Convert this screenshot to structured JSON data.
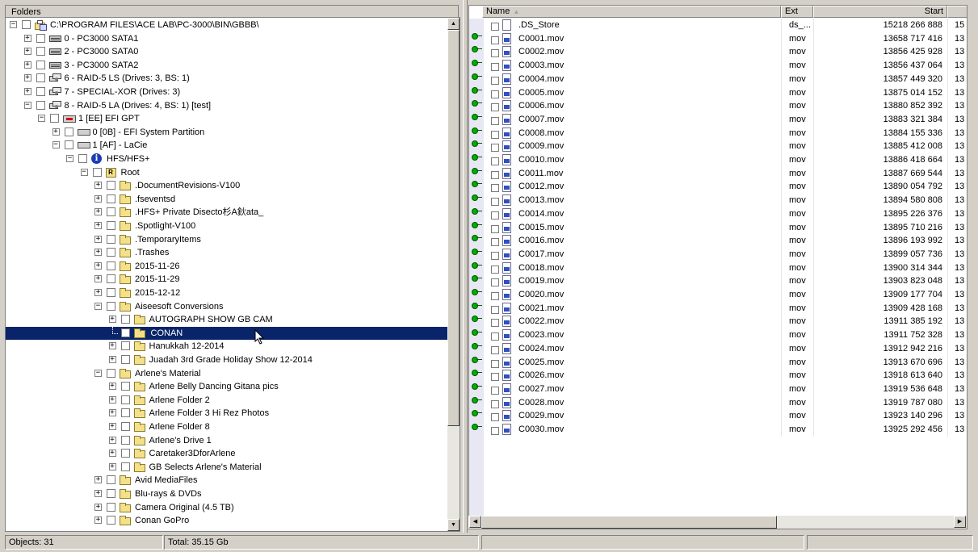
{
  "folders_pane": {
    "header": "Folders",
    "tree": [
      {
        "level": 0,
        "label": "C:\\PROGRAM FILES\\ACE LAB\\PC-3000\\BIN\\GBBB\\",
        "icon": "root-folder-icon",
        "exp": "-"
      },
      {
        "level": 1,
        "label": "0 - PC3000 SATA1",
        "icon": "drive-icon",
        "exp": "+"
      },
      {
        "level": 1,
        "label": "2 - PC3000 SATA0",
        "icon": "drive-icon",
        "exp": "+"
      },
      {
        "level": 1,
        "label": "3 - PC3000 SATA2",
        "icon": "drive-icon",
        "exp": "+"
      },
      {
        "level": 1,
        "label": "6 - RAID-5 LS (Drives: 3, BS: 1)",
        "icon": "raid-icon",
        "exp": "+"
      },
      {
        "level": 1,
        "label": "7 - SPECIAL-XOR (Drives: 3)",
        "icon": "raid-icon",
        "exp": "+"
      },
      {
        "level": 1,
        "label": "8 - RAID-5 LA (Drives: 4, BS: 1) [test]",
        "icon": "raid-icon",
        "exp": "-"
      },
      {
        "level": 2,
        "label": "1 [EE] EFI GPT",
        "icon": "efi-icon",
        "exp": "-"
      },
      {
        "level": 3,
        "label": "0 [0B] - EFI System Partition",
        "icon": "partition-icon",
        "exp": "+"
      },
      {
        "level": 3,
        "label": "1 [AF] - LaCie",
        "icon": "partition-icon",
        "exp": "-"
      },
      {
        "level": 4,
        "label": "HFS/HFS+",
        "icon": "info-icon",
        "exp": "-"
      },
      {
        "level": 5,
        "label": "Root",
        "icon": "root-icon",
        "exp": "-"
      },
      {
        "level": 6,
        "label": ".DocumentRevisions-V100",
        "icon": "folder-icon",
        "exp": "+"
      },
      {
        "level": 6,
        "label": ".fseventsd",
        "icon": "folder-icon",
        "exp": "+"
      },
      {
        "level": 6,
        "label": ".HFS+ Private Disecto杉A鈥ata_",
        "icon": "folder-icon",
        "exp": "+"
      },
      {
        "level": 6,
        "label": ".Spotlight-V100",
        "icon": "folder-icon",
        "exp": "+"
      },
      {
        "level": 6,
        "label": ".TemporaryItems",
        "icon": "folder-icon",
        "exp": "+"
      },
      {
        "level": 6,
        "label": ".Trashes",
        "icon": "folder-icon",
        "exp": "+"
      },
      {
        "level": 6,
        "label": "2015-11-26",
        "icon": "folder-icon",
        "exp": "+"
      },
      {
        "level": 6,
        "label": "2015-11-29",
        "icon": "folder-icon",
        "exp": "+"
      },
      {
        "level": 6,
        "label": "2015-12-12",
        "icon": "folder-icon",
        "exp": "+"
      },
      {
        "level": 6,
        "label": "Aiseesoft Conversions",
        "icon": "folder-icon",
        "exp": "-"
      },
      {
        "level": 7,
        "label": "AUTOGRAPH SHOW GB CAM",
        "icon": "folder-icon",
        "exp": "+"
      },
      {
        "level": 7,
        "label": "CONAN",
        "icon": "folder-icon",
        "exp": "",
        "selected": true
      },
      {
        "level": 7,
        "label": "Hanukkah 12-2014",
        "icon": "folder-icon",
        "exp": "+"
      },
      {
        "level": 7,
        "label": "Juadah 3rd Grade Holiday Show 12-2014",
        "icon": "folder-icon",
        "exp": "+"
      },
      {
        "level": 6,
        "label": "Arlene's Material",
        "icon": "folder-icon",
        "exp": "-"
      },
      {
        "level": 7,
        "label": "Arlene Belly Dancing Gitana pics",
        "icon": "folder-icon",
        "exp": "+"
      },
      {
        "level": 7,
        "label": "Arlene Folder 2",
        "icon": "folder-icon",
        "exp": "+"
      },
      {
        "level": 7,
        "label": "Arlene Folder 3 Hi Rez Photos",
        "icon": "folder-icon",
        "exp": "+"
      },
      {
        "level": 7,
        "label": "Arlene Folder 8",
        "icon": "folder-icon",
        "exp": "+"
      },
      {
        "level": 7,
        "label": "Arlene's Drive 1",
        "icon": "folder-icon",
        "exp": "+"
      },
      {
        "level": 7,
        "label": "Caretaker3DforArlene",
        "icon": "folder-icon",
        "exp": "+"
      },
      {
        "level": 7,
        "label": "GB Selects Arlene's Material",
        "icon": "folder-icon",
        "exp": "+"
      },
      {
        "level": 6,
        "label": "Avid MediaFiles",
        "icon": "folder-icon",
        "exp": "+"
      },
      {
        "level": 6,
        "label": "Blu-rays & DVDs",
        "icon": "folder-icon",
        "exp": "+"
      },
      {
        "level": 6,
        "label": "Camera Original (4.5 TB)",
        "icon": "folder-icon",
        "exp": "+"
      },
      {
        "level": 6,
        "label": "Conan GoPro",
        "icon": "folder-icon",
        "exp": "+"
      }
    ]
  },
  "file_list": {
    "columns": {
      "name": "Name",
      "ext": "Ext",
      "start": "Start"
    },
    "sort_indicator": "▲",
    "rows": [
      {
        "name": ".DS_Store",
        "ext": "ds_...",
        "start": "15218 266 888",
        "extra": "15",
        "type": "plain"
      },
      {
        "name": "C0001.mov",
        "ext": "mov",
        "start": "13658 717 416",
        "extra": "13",
        "type": "mov"
      },
      {
        "name": "C0002.mov",
        "ext": "mov",
        "start": "13856 425 928",
        "extra": "13",
        "type": "mov"
      },
      {
        "name": "C0003.mov",
        "ext": "mov",
        "start": "13856 437 064",
        "extra": "13",
        "type": "mov"
      },
      {
        "name": "C0004.mov",
        "ext": "mov",
        "start": "13857 449 320",
        "extra": "13",
        "type": "mov"
      },
      {
        "name": "C0005.mov",
        "ext": "mov",
        "start": "13875 014 152",
        "extra": "13",
        "type": "mov"
      },
      {
        "name": "C0006.mov",
        "ext": "mov",
        "start": "13880 852 392",
        "extra": "13",
        "type": "mov"
      },
      {
        "name": "C0007.mov",
        "ext": "mov",
        "start": "13883 321 384",
        "extra": "13",
        "type": "mov"
      },
      {
        "name": "C0008.mov",
        "ext": "mov",
        "start": "13884 155 336",
        "extra": "13",
        "type": "mov"
      },
      {
        "name": "C0009.mov",
        "ext": "mov",
        "start": "13885 412 008",
        "extra": "13",
        "type": "mov"
      },
      {
        "name": "C0010.mov",
        "ext": "mov",
        "start": "13886 418 664",
        "extra": "13",
        "type": "mov"
      },
      {
        "name": "C0011.mov",
        "ext": "mov",
        "start": "13887 669 544",
        "extra": "13",
        "type": "mov"
      },
      {
        "name": "C0012.mov",
        "ext": "mov",
        "start": "13890 054 792",
        "extra": "13",
        "type": "mov"
      },
      {
        "name": "C0013.mov",
        "ext": "mov",
        "start": "13894 580 808",
        "extra": "13",
        "type": "mov"
      },
      {
        "name": "C0014.mov",
        "ext": "mov",
        "start": "13895 226 376",
        "extra": "13",
        "type": "mov"
      },
      {
        "name": "C0015.mov",
        "ext": "mov",
        "start": "13895 710 216",
        "extra": "13",
        "type": "mov"
      },
      {
        "name": "C0016.mov",
        "ext": "mov",
        "start": "13896 193 992",
        "extra": "13",
        "type": "mov"
      },
      {
        "name": "C0017.mov",
        "ext": "mov",
        "start": "13899 057 736",
        "extra": "13",
        "type": "mov"
      },
      {
        "name": "C0018.mov",
        "ext": "mov",
        "start": "13900 314 344",
        "extra": "13",
        "type": "mov"
      },
      {
        "name": "C0019.mov",
        "ext": "mov",
        "start": "13903 823 048",
        "extra": "13",
        "type": "mov"
      },
      {
        "name": "C0020.mov",
        "ext": "mov",
        "start": "13909 177 704",
        "extra": "13",
        "type": "mov"
      },
      {
        "name": "C0021.mov",
        "ext": "mov",
        "start": "13909 428 168",
        "extra": "13",
        "type": "mov"
      },
      {
        "name": "C0022.mov",
        "ext": "mov",
        "start": "13911 385 192",
        "extra": "13",
        "type": "mov"
      },
      {
        "name": "C0023.mov",
        "ext": "mov",
        "start": "13911 752 328",
        "extra": "13",
        "type": "mov"
      },
      {
        "name": "C0024.mov",
        "ext": "mov",
        "start": "13912 942 216",
        "extra": "13",
        "type": "mov"
      },
      {
        "name": "C0025.mov",
        "ext": "mov",
        "start": "13913 670 696",
        "extra": "13",
        "type": "mov"
      },
      {
        "name": "C0026.mov",
        "ext": "mov",
        "start": "13918 613 640",
        "extra": "13",
        "type": "mov"
      },
      {
        "name": "C0027.mov",
        "ext": "mov",
        "start": "13919 536 648",
        "extra": "13",
        "type": "mov"
      },
      {
        "name": "C0028.mov",
        "ext": "mov",
        "start": "13919 787 080",
        "extra": "13",
        "type": "mov"
      },
      {
        "name": "C0029.mov",
        "ext": "mov",
        "start": "13923 140 296",
        "extra": "13",
        "type": "mov"
      },
      {
        "name": "C0030.mov",
        "ext": "mov",
        "start": "13925 292 456",
        "extra": "13",
        "type": "mov"
      }
    ]
  },
  "status_bar": {
    "objects": "Objects: 31",
    "total": "Total: 35.15 Gb"
  },
  "colors": {
    "selection": "#0a246a",
    "window_bg": "#d4d0c8"
  }
}
